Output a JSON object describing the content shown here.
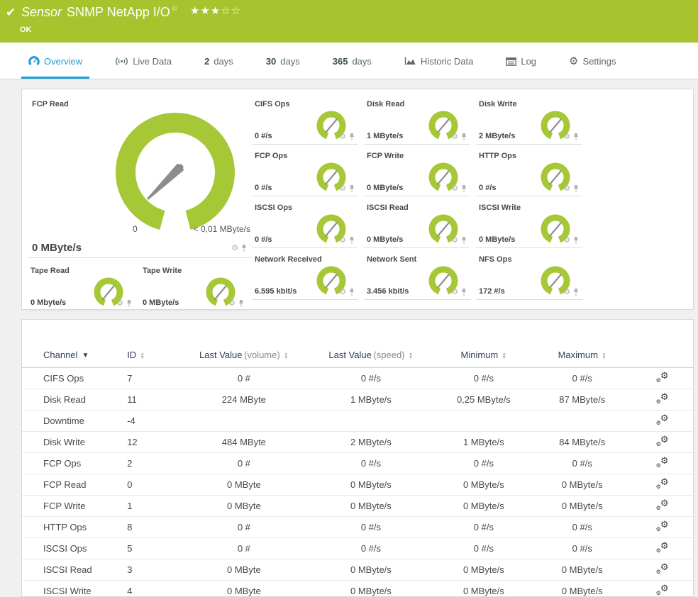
{
  "header": {
    "status_icon": "check",
    "sensor_label": "Sensor",
    "sensor_name": "SNMP NetApp I/O",
    "flag_icon": "flag",
    "stars": "★★★☆☆",
    "status": "OK",
    "green": "#a7c32d"
  },
  "tabs": [
    {
      "label": "Overview",
      "icon": "gauge-icon",
      "active": true
    },
    {
      "label": "Live Data",
      "icon": "live-data-icon"
    },
    {
      "strong": "2",
      "label": "days"
    },
    {
      "strong": "30",
      "label": "days"
    },
    {
      "strong": "365",
      "label": "days"
    },
    {
      "label": "Historic Data",
      "icon": "area-chart-icon"
    },
    {
      "label": "Log",
      "icon": "log-icon"
    },
    {
      "label": "Settings",
      "icon": "gear-icon"
    }
  ],
  "colors": {
    "gauge_green": "#a6c836",
    "needle_gray": "#8c8c8c",
    "accent_blue": "#1e9cd7"
  },
  "big_gauge": {
    "title": "FCP Read",
    "value": "0 MByte/s",
    "scale_min": "0",
    "scale_max": "< 0,01 MByte/s"
  },
  "small_gauges": [
    {
      "title": "CIFS Ops",
      "value": "0 #/s"
    },
    {
      "title": "Disk Read",
      "value": "1 MByte/s"
    },
    {
      "title": "Disk Write",
      "value": "2 MByte/s"
    },
    {
      "title": "FCP Ops",
      "value": "0 #/s"
    },
    {
      "title": "FCP Write",
      "value": "0 MByte/s"
    },
    {
      "title": "HTTP Ops",
      "value": "0 #/s"
    },
    {
      "title": "ISCSI Ops",
      "value": "0 #/s"
    },
    {
      "title": "ISCSI Read",
      "value": "0 MByte/s"
    },
    {
      "title": "ISCSI Write",
      "value": "0 MByte/s"
    },
    {
      "title": "Network Received",
      "value": "6.595 kbit/s"
    },
    {
      "title": "Network Sent",
      "value": "3.456 kbit/s"
    },
    {
      "title": "NFS Ops",
      "value": "172 #/s"
    }
  ],
  "tape_gauges": [
    {
      "title": "Tape Read",
      "value": "0 Mbyte/s"
    },
    {
      "title": "Tape Write",
      "value": "0 MByte/s"
    }
  ],
  "table": {
    "columns": [
      {
        "label": "Channel"
      },
      {
        "label": "ID"
      },
      {
        "label": "Last Value",
        "sub": "(volume)"
      },
      {
        "label": "Last Value",
        "sub": "(speed)"
      },
      {
        "label": "Minimum"
      },
      {
        "label": "Maximum"
      }
    ],
    "rows": [
      {
        "channel": "CIFS Ops",
        "id": "7",
        "vol": "0 #",
        "speed": "0 #/s",
        "min": "0 #/s",
        "max": "0 #/s"
      },
      {
        "channel": "Disk Read",
        "id": "11",
        "vol": "224 MByte",
        "speed": "1 MByte/s",
        "min": "0,25 MByte/s",
        "max": "87 MByte/s"
      },
      {
        "channel": "Downtime",
        "id": "-4",
        "vol": "",
        "speed": "",
        "min": "",
        "max": ""
      },
      {
        "channel": "Disk Write",
        "id": "12",
        "vol": "484 MByte",
        "speed": "2 MByte/s",
        "min": "1 MByte/s",
        "max": "84 MByte/s"
      },
      {
        "channel": "FCP Ops",
        "id": "2",
        "vol": "0 #",
        "speed": "0 #/s",
        "min": "0 #/s",
        "max": "0 #/s"
      },
      {
        "channel": "FCP Read",
        "id": "0",
        "vol": "0 MByte",
        "speed": "0 MByte/s",
        "min": "0 MByte/s",
        "max": "0 MByte/s"
      },
      {
        "channel": "FCP Write",
        "id": "1",
        "vol": "0 MByte",
        "speed": "0 MByte/s",
        "min": "0 MByte/s",
        "max": "0 MByte/s"
      },
      {
        "channel": "HTTP Ops",
        "id": "8",
        "vol": "0 #",
        "speed": "0 #/s",
        "min": "0 #/s",
        "max": "0 #/s"
      },
      {
        "channel": "ISCSI Ops",
        "id": "5",
        "vol": "0 #",
        "speed": "0 #/s",
        "min": "0 #/s",
        "max": "0 #/s"
      },
      {
        "channel": "ISCSI Read",
        "id": "3",
        "vol": "0 MByte",
        "speed": "0 MByte/s",
        "min": "0 MByte/s",
        "max": "0 MByte/s"
      },
      {
        "channel": "ISCSI Write",
        "id": "4",
        "vol": "0 MByte",
        "speed": "0 MByte/s",
        "min": "0 MByte/s",
        "max": "0 MByte/s"
      }
    ]
  },
  "icons": {
    "gear": "⚙",
    "check": "✔",
    "flag": "⚐",
    "sort_up": "▲",
    "sort_down": "▼"
  }
}
